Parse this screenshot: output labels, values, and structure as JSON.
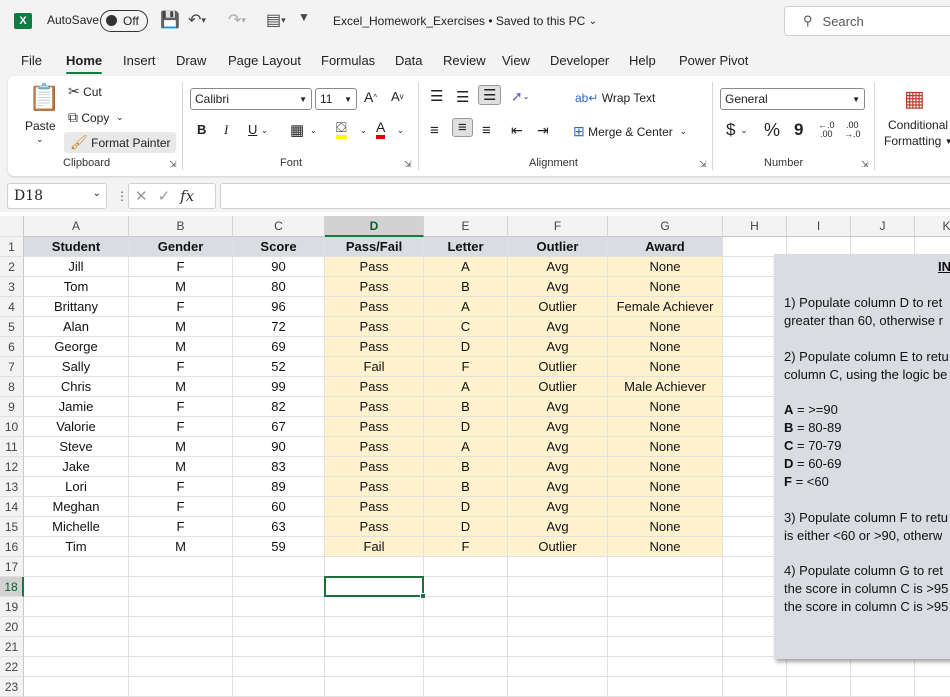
{
  "titlebar": {
    "app_logo": "X",
    "autosave_label": "AutoSave",
    "autosave_state": "Off",
    "doc_title": "Excel_Homework_Exercises • Saved to this PC",
    "search_placeholder": "Search"
  },
  "menu": [
    "File",
    "Home",
    "Insert",
    "Draw",
    "Page Layout",
    "Formulas",
    "Data",
    "Review",
    "View",
    "Developer",
    "Help",
    "Power Pivot"
  ],
  "ribbon": {
    "clipboard": {
      "paste": "Paste",
      "cut": "Cut",
      "copy": "Copy",
      "format_painter": "Format Painter",
      "label": "Clipboard"
    },
    "font": {
      "name": "Calibri",
      "size": "11",
      "bold": "B",
      "italic": "I",
      "underline": "U",
      "label": "Font"
    },
    "alignment": {
      "wrap_text": "Wrap Text",
      "merge_center": "Merge & Center",
      "label": "Alignment"
    },
    "number": {
      "format": "General",
      "currency": "$",
      "percent": "%",
      "comma": "9",
      "label": "Number"
    },
    "styles": {
      "conditional": "Conditional",
      "formatting": "Formatting"
    }
  },
  "formula_bar": {
    "name_box": "D18",
    "fx": "fx",
    "formula": ""
  },
  "columns": [
    "A",
    "B",
    "C",
    "D",
    "E",
    "F",
    "G",
    "H",
    "I",
    "J",
    "K"
  ],
  "rows": [
    "1",
    "2",
    "3",
    "4",
    "5",
    "6",
    "7",
    "8",
    "9",
    "10",
    "11",
    "12",
    "13",
    "14",
    "15",
    "16",
    "17",
    "18",
    "19",
    "20",
    "21",
    "22",
    "23"
  ],
  "headers": [
    "Student",
    "Gender",
    "Score",
    "Pass/Fail",
    "Letter",
    "Outlier",
    "Award"
  ],
  "table": [
    [
      "Jill",
      "F",
      "90",
      "Pass",
      "A",
      "Avg",
      "None"
    ],
    [
      "Tom",
      "M",
      "80",
      "Pass",
      "B",
      "Avg",
      "None"
    ],
    [
      "Brittany",
      "F",
      "96",
      "Pass",
      "A",
      "Outlier",
      "Female Achiever"
    ],
    [
      "Alan",
      "M",
      "72",
      "Pass",
      "C",
      "Avg",
      "None"
    ],
    [
      "George",
      "M",
      "69",
      "Pass",
      "D",
      "Avg",
      "None"
    ],
    [
      "Sally",
      "F",
      "52",
      "Fail",
      "F",
      "Outlier",
      "None"
    ],
    [
      "Chris",
      "M",
      "99",
      "Pass",
      "A",
      "Outlier",
      "Male Achiever"
    ],
    [
      "Jamie",
      "F",
      "82",
      "Pass",
      "B",
      "Avg",
      "None"
    ],
    [
      "Valorie",
      "F",
      "67",
      "Pass",
      "D",
      "Avg",
      "None"
    ],
    [
      "Steve",
      "M",
      "90",
      "Pass",
      "A",
      "Avg",
      "None"
    ],
    [
      "Jake",
      "M",
      "83",
      "Pass",
      "B",
      "Avg",
      "None"
    ],
    [
      "Lori",
      "F",
      "89",
      "Pass",
      "B",
      "Avg",
      "None"
    ],
    [
      "Meghan",
      "F",
      "60",
      "Pass",
      "D",
      "Avg",
      "None"
    ],
    [
      "Michelle",
      "F",
      "63",
      "Pass",
      "D",
      "Avg",
      "None"
    ],
    [
      "Tim",
      "M",
      "59",
      "Fail",
      "F",
      "Outlier",
      "None"
    ]
  ],
  "instructions": {
    "title": "IN",
    "lines": [
      "1) Populate column D to ret",
      "greater than 60, otherwise r",
      "2) Populate column E to retu",
      "column C, using the logic be",
      "3) Populate column F to retu",
      "is either <60 or >90, otherw",
      "4) Populate column G to ret",
      "the score in column C is >95",
      "the score in column C is >95"
    ],
    "grades": [
      {
        "letter": "A",
        "range": " = >=90"
      },
      {
        "letter": "B",
        "range": " = 80-89"
      },
      {
        "letter": "C",
        "range": " = 70-79"
      },
      {
        "letter": "D",
        "range": " = 60-69"
      },
      {
        "letter": "F",
        "range": " = <60"
      }
    ]
  },
  "colors": {
    "accent": "#107c41",
    "header_fill": "#d9dce1",
    "highlight_fill": "#fff2cc"
  }
}
